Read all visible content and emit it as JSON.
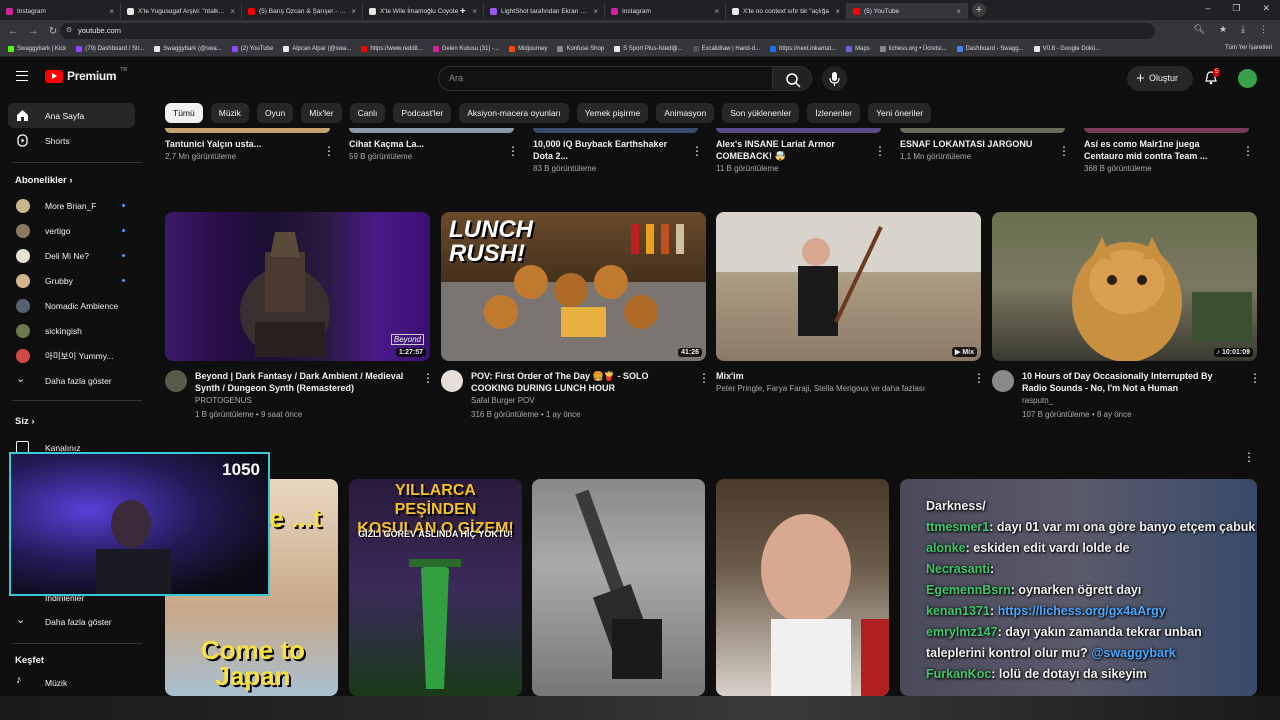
{
  "browser": {
    "tabs": [
      {
        "label": "Instagram",
        "color": "#d6249f"
      },
      {
        "label": "X'te Yugusugaf Arşivi: \"ntalks de",
        "color": "#e8e8e8"
      },
      {
        "label": "(5) Barış Özcan & Şarışer - Kon",
        "color": "#ff0000"
      },
      {
        "label": "X'te Wile İmamoğlu Coyote ✚",
        "color": "#e8e8e8"
      },
      {
        "label": "LightShot tarafından Ekran Gör",
        "color": "#9b59ff"
      },
      {
        "label": "Instagram",
        "color": "#d6249f"
      },
      {
        "label": "X'te no context sıfır bir \"açlığa",
        "color": "#e8e8e8"
      },
      {
        "label": "(5) YouTube",
        "color": "#ff0000"
      }
    ],
    "url": "youtube.com",
    "bookmarks": [
      "Swaggybark | Kick",
      "(79) Dashboard / Str...",
      "Swaggybark (@swa...",
      "(2) YouTube",
      "Alpcan Alpar (@swa...",
      "https://www.reddit...",
      "Gelen Kutusu (31) -...",
      "Midjourney",
      "Konfuse Shop",
      "S Sport Plus-İstediği...",
      "Excalidraw | Hand-d...",
      "https://next.inkamat...",
      "Maps",
      "lichess.org • Ücretsi...",
      "Dashboard - Swagg...",
      "V0.8 - Google Dokü..."
    ],
    "all_bookmarks": "Tüm Yer İşaretleri"
  },
  "youtube": {
    "logo_text": "Premium",
    "logo_sup": "TR",
    "search_placeholder": "Ara",
    "create_label": "Oluştur",
    "notif_count": "5",
    "chips": [
      "Tümü",
      "Müzik",
      "Oyun",
      "Mix'ler",
      "Canlı",
      "Podcast'ler",
      "Aksiyon-macera oyunları",
      "Yemek pişirme",
      "Animasyon",
      "Son yüklenenler",
      "İzlenenler",
      "Yeni öneriler"
    ]
  },
  "sidebar": {
    "home": "Ana Sayfa",
    "shorts": "Shorts",
    "subs_header": "Abonelikler",
    "subs": [
      {
        "name": "More Brian_F",
        "color": "#c9b98a"
      },
      {
        "name": "vertigo",
        "color": "#8a7a60"
      },
      {
        "name": "Deli Mi Ne?",
        "color": "#e8e0d0"
      },
      {
        "name": "Grubby",
        "color": "#d4b48a"
      },
      {
        "name": "Nomadic Ambience",
        "color": "#556070"
      },
      {
        "name": "sickingish",
        "color": "#6a7a4a"
      },
      {
        "name": "아미보이 Yummy...",
        "color": "#d04848"
      }
    ],
    "show_more": "Daha fazla göster",
    "you_header": "Siz",
    "channel": "Kanalınız",
    "partial": "İndirilenler",
    "show_more2": "Daha fazla göster",
    "explore_header": "Keşfet",
    "music": "Müzik"
  },
  "row_top": [
    {
      "title": "Tantunici Yalçın usta...",
      "sub": "2,7 Mn görüntüleme"
    },
    {
      "title": "Cihat Kaçma La...",
      "sub": "59 B görüntüleme"
    },
    {
      "title": "10,000 iQ Buyback Earthshaker Dota 2...",
      "sub": "83 B görüntüleme"
    },
    {
      "title": "Alex's INSANE Lariat Armor COMEBACK! 🤯",
      "sub": "11 B görüntüleme"
    },
    {
      "title": "ESNAF LOKANTASI JARGONU",
      "sub": "1,1 Mn görüntüleme"
    },
    {
      "title": "Así es como Malr1ne juega Centauro mid contra Team ...",
      "sub": "368 B görüntüleme"
    }
  ],
  "videos": [
    {
      "title": "Beyond | Dark Fantasy / Dark Ambient / Medieval Synth / Dungeon Synth (Remastered)",
      "channel": "PROTOGENUS",
      "stats": "1 B görüntüleme • 9 saat önce",
      "duration": "1:27:57",
      "thumb_text": "Beyond"
    },
    {
      "title": "POV: First Order of The Day 🍔🍟 - SOLO COOKING DURING LUNCH HOUR",
      "channel": "Safal Burger POV",
      "stats": "316 B görüntüleme • 1 ay önce",
      "duration": "41:26",
      "thumb_text": "LUNCH RUSH!"
    },
    {
      "title": "Mix'im",
      "channel": "Peter Pringle, Farya Faraji, Stella Merigoux ve daha fazlası",
      "stats": "",
      "duration": "Mix",
      "thumb_text": ""
    },
    {
      "title": "10 Hours of Day Occasionally Interrupted By Radio Sounds - No, I'm Not a Human",
      "channel": "rasputn_",
      "stats": "107 B görüntüleme • 8 ay önce",
      "duration": "10:01:09",
      "thumb_text": ""
    }
  ],
  "shorts_thumbs": [
    "se ...t",
    "YILLARCA PEŞİNDEN KOŞULAN O GİZEM!",
    "GİZLİ GÖREV ASLINDA HİÇ YOKTU!",
    "Come to Japan"
  ],
  "overlay": {
    "counter": "1050",
    "chat": [
      {
        "user": "",
        "msg": "Darkness/",
        "link": ""
      },
      {
        "user": "ttmesmer1",
        "msg": ": dayı 01 var mı ona göre banyo etçem çabuk",
        "link": ""
      },
      {
        "user": "alonke",
        "msg": ": eskiden edit vardı lolde de",
        "link": ""
      },
      {
        "user": "Necrasanti",
        "msg": ":",
        "link": ""
      },
      {
        "user": "EgemennBsrn",
        "msg": ": oynarken öğrett dayı",
        "link": ""
      },
      {
        "user": "kenan1371",
        "msg": ":",
        "link": "https://lichess.org/gx4aArgy"
      },
      {
        "user": "emrylmz147",
        "msg": ": dayı yakın zamanda tekrar unban taleplerini kontrol olur mu?",
        "link": "@swaggybark"
      },
      {
        "user": "FurkanKoc",
        "msg": ": lolü de dotayı da sikeyim",
        "link": ""
      }
    ]
  }
}
